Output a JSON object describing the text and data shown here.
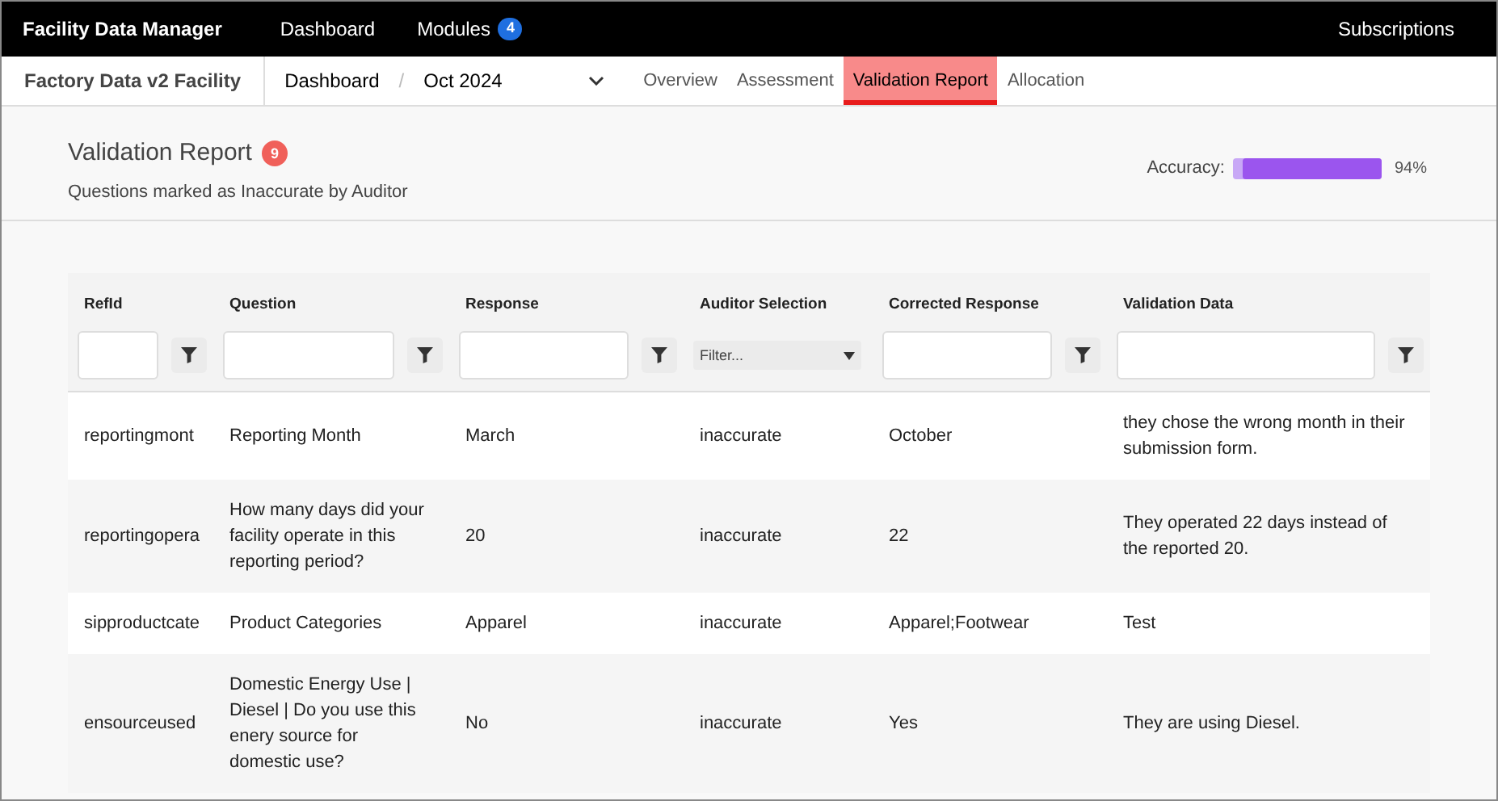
{
  "top_bar": {
    "title": "Facility Data Manager",
    "nav": [
      {
        "label": "Dashboard"
      },
      {
        "label": "Modules",
        "badge": "4"
      }
    ],
    "right_link": "Subscriptions"
  },
  "sub_nav": {
    "facility": "Factory Data v2 Facility",
    "breadcrumb": "Dashboard",
    "separator": "/",
    "period": "Oct 2024",
    "tabs": [
      {
        "label": "Overview",
        "selected": false
      },
      {
        "label": "Assessment",
        "selected": false
      },
      {
        "label": "Validation Report",
        "selected": true
      },
      {
        "label": "Allocation",
        "selected": false
      }
    ]
  },
  "header": {
    "title": "Validation Report",
    "count": "9",
    "subtitle": "Questions marked as Inaccurate by Auditor",
    "accuracy_label": "Accuracy:",
    "accuracy": {
      "level": 0.94
    },
    "accuracy_reading": "94%"
  },
  "table": {
    "columns": [
      {
        "label": "RefId",
        "kind": "text"
      },
      {
        "label": "Question",
        "kind": "text"
      },
      {
        "label": "Response",
        "kind": "text"
      },
      {
        "label": "Auditor Selection",
        "kind": "select",
        "placeholder": "Filter..."
      },
      {
        "label": "Corrected Response",
        "kind": "text"
      },
      {
        "label": "Validation Data",
        "kind": "text"
      }
    ],
    "rows": [
      {
        "cells": [
          "reportingmont",
          "Reporting Month",
          "March",
          "inaccurate",
          "October",
          "they chose the wrong month in their submission form."
        ]
      },
      {
        "cells": [
          "reportingopera",
          "How many days did your facility operate in this reporting period?",
          "20",
          "inaccurate",
          "22",
          "They operated 22 days instead of the reported 20."
        ]
      },
      {
        "cells": [
          "sipproductcate",
          "Product Categories",
          "Apparel",
          "inaccurate",
          "Apparel;Footwear",
          "Test"
        ]
      },
      {
        "cells": [
          "ensourceused",
          "Domestic Energy Use | Diesel | Do you use this enery source for domestic use?",
          "No",
          "inaccurate",
          "Yes",
          "They are using Diesel."
        ]
      }
    ]
  }
}
